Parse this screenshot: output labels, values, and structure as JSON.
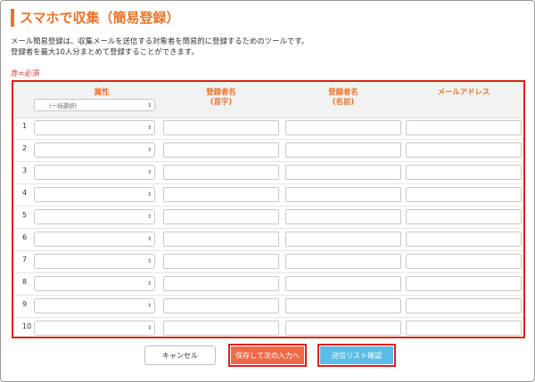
{
  "page": {
    "title": "スマホで収集（簡易登録）",
    "description_line1": "メール簡易登録は、収集メールを送信する対象者を簡易的に登録するためのツールです。",
    "description_line2": "登録者を最大10人分まとめて登録することができます。",
    "required_note": "赤=必須"
  },
  "table": {
    "headers": {
      "attribute": "属性",
      "bulk_select": "(一括選択)",
      "last_name_line1": "登録者名",
      "last_name_line2": "(苗字)",
      "first_name_line1": "登録者名",
      "first_name_line2": "(名前)",
      "email": "メールアドレス"
    },
    "rows": [
      "1",
      "2",
      "3",
      "4",
      "5",
      "6",
      "7",
      "8",
      "9",
      "10"
    ]
  },
  "buttons": {
    "cancel": "キャンセル",
    "save_next": "保存して次の入力へ",
    "confirm_list": "送信リスト確認"
  },
  "colors": {
    "accent": "#e8742a",
    "required": "#d23a2a",
    "highlight_border": "#d8221c",
    "save_button": "#f06a48",
    "list_button": "#5bbde6"
  }
}
